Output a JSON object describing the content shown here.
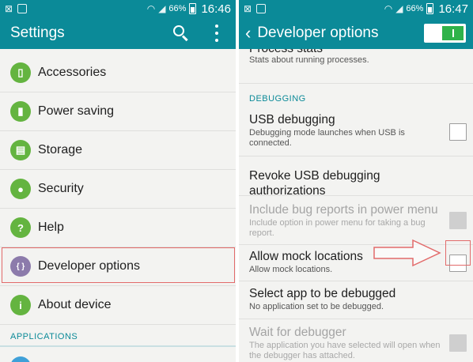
{
  "left": {
    "status": {
      "battery_pct": "66%",
      "time": "16:46"
    },
    "title": "Settings",
    "items": [
      {
        "label": "Accessories",
        "icon": "accessories-icon"
      },
      {
        "label": "Power saving",
        "icon": "battery-icon"
      },
      {
        "label": "Storage",
        "icon": "storage-icon"
      },
      {
        "label": "Security",
        "icon": "lock-icon"
      },
      {
        "label": "Help",
        "icon": "help-icon",
        "glyph": "?"
      },
      {
        "label": "Developer options",
        "icon": "code-braces-icon",
        "glyph": "{ }"
      },
      {
        "label": "About device",
        "icon": "info-icon",
        "glyph": "i"
      }
    ],
    "section": "APPLICATIONS"
  },
  "right": {
    "status": {
      "battery_pct": "66%",
      "time": "16:47"
    },
    "title": "Developer options",
    "toggle_on": true,
    "process_stats": {
      "title": "Process stats",
      "summary": "Stats about running processes."
    },
    "section": "DEBUGGING",
    "items": [
      {
        "title": "USB debugging",
        "summary": "Debugging mode launches when USB is connected.",
        "checkbox": true,
        "checked": false,
        "enabled": true
      },
      {
        "title": "Revoke USB debugging authorizations",
        "summary": "",
        "checkbox": false,
        "enabled": true
      },
      {
        "title": "Include bug reports in power menu",
        "summary": "Include option in power menu for taking a bug report.",
        "checkbox": true,
        "checked": false,
        "enabled": false
      },
      {
        "title": "Allow mock locations",
        "summary": "Allow mock locations.",
        "checkbox": true,
        "checked": false,
        "enabled": true
      },
      {
        "title": "Select app to be debugged",
        "summary": "No application set to be debugged.",
        "checkbox": false,
        "enabled": true
      },
      {
        "title": "Wait for debugger",
        "summary": "The application you have selected will open when the debugger has attached.",
        "checkbox": true,
        "checked": false,
        "enabled": false
      }
    ]
  },
  "colors": {
    "accent": "#0b8a98",
    "icon_green": "#64b440",
    "dev_icon_purple": "#8c7bab",
    "annotation_red": "#e26a6a",
    "toggle_green": "#2fb34a"
  }
}
